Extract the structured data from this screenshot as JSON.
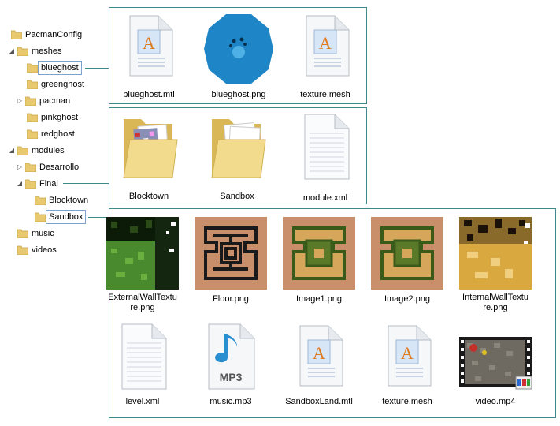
{
  "tree": {
    "items": [
      {
        "label": "PacmanConfig",
        "arrow": ""
      },
      {
        "label": "meshes",
        "arrow": "expanded"
      },
      {
        "label": "blueghost",
        "arrow": ""
      },
      {
        "label": "greenghost",
        "arrow": ""
      },
      {
        "label": "pacman",
        "arrow": "collapsed"
      },
      {
        "label": "pinkghost",
        "arrow": ""
      },
      {
        "label": "redghost",
        "arrow": ""
      },
      {
        "label": "modules",
        "arrow": "expanded"
      },
      {
        "label": "Desarrollo",
        "arrow": "collapsed"
      },
      {
        "label": "Final",
        "arrow": "expanded"
      },
      {
        "label": "Blocktown",
        "arrow": ""
      },
      {
        "label": "Sandbox",
        "arrow": ""
      },
      {
        "label": "music",
        "arrow": ""
      },
      {
        "label": "videos",
        "arrow": ""
      }
    ],
    "arrow_glyphs": {
      "expanded": "◢",
      "collapsed": "▷"
    }
  },
  "panels": {
    "blueghost": {
      "files": [
        {
          "name": "blueghost.mtl",
          "icon": "document-icon"
        },
        {
          "name": "blueghost.png",
          "icon": "ghost-image"
        },
        {
          "name": "texture.mesh",
          "icon": "document-icon"
        }
      ]
    },
    "final": {
      "files": [
        {
          "name": "Blocktown",
          "icon": "folder-with-content-icon"
        },
        {
          "name": "Sandbox",
          "icon": "folder-with-content-icon"
        },
        {
          "name": "module.xml",
          "icon": "text-file-icon"
        }
      ]
    },
    "sandbox": {
      "files": [
        {
          "name": "ExternalWallTexture.png",
          "line1": "ExternalWallTextu",
          "line2": "re.png",
          "icon": "green-texture-image"
        },
        {
          "name": "Floor.png",
          "icon": "maze-floor-image"
        },
        {
          "name": "Image1.png",
          "icon": "maze-tile-image"
        },
        {
          "name": "Image2.png",
          "icon": "maze-tile-image"
        },
        {
          "name": "InternalWallTexture.png",
          "line1": "InternalWallTextu",
          "line2": "re.png",
          "icon": "yellow-texture-image"
        },
        {
          "name": "level.xml",
          "icon": "text-file-icon"
        },
        {
          "name": "music.mp3",
          "icon": "mp3-icon",
          "badge": "MP3"
        },
        {
          "name": "SandboxLand.mtl",
          "icon": "document-icon"
        },
        {
          "name": "texture.mesh",
          "icon": "document-icon"
        },
        {
          "name": "video.mp4",
          "icon": "video-icon"
        }
      ]
    }
  },
  "colors": {
    "panel_border": "#3d8a8d",
    "folder": "#e8c970",
    "ghost_blue": "#1e86c6",
    "selection_border": "#7da2ce"
  }
}
